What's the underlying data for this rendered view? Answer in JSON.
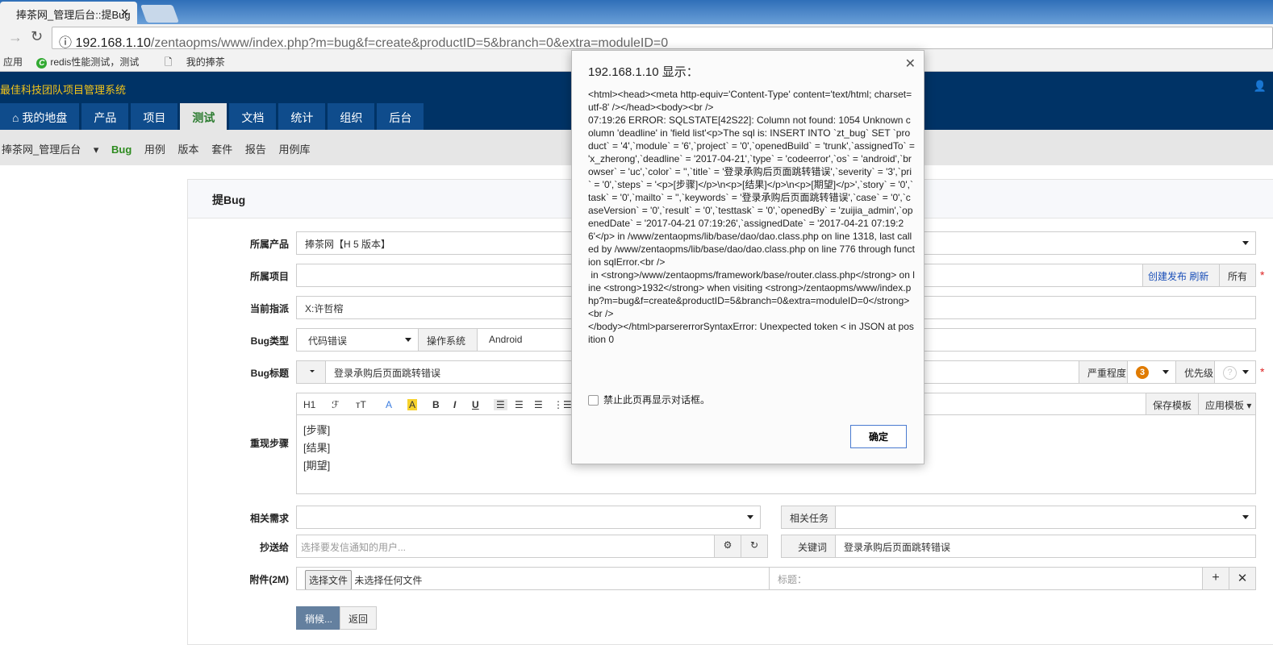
{
  "browser": {
    "tab_title": "捧茶网_管理后台::提Bug",
    "url_host": "192.168.1.10",
    "url_rest": "/zentaopms/www/index.php?m=bug&f=create&productID=5&branch=0&extra=moduleID=0",
    "bookmarks": [
      "应用",
      "redis性能测试，测试",
      "我的捧茶"
    ]
  },
  "app": {
    "title": "最佳科技团队项目管理系统",
    "nav": [
      "我的地盘",
      "产品",
      "项目",
      "测试",
      "文档",
      "统计",
      "组织",
      "后台"
    ],
    "subnav": {
      "product": "捧茶网_管理后台",
      "items": [
        "Bug",
        "用例",
        "版本",
        "套件",
        "报告",
        "用例库"
      ]
    }
  },
  "form": {
    "heading": "提Bug",
    "product_label": "所属产品",
    "product_value": "捧茶网【H 5 版本】",
    "project_label": "所属项目",
    "create_build": "创建发布",
    "refresh": "刷新",
    "all": "所有",
    "assign_label": "当前指派",
    "assign_value": "X:许哲榕",
    "type_label": "Bug类型",
    "type_value": "代码错误",
    "os_label": "操作系统",
    "os_value": "Android",
    "title_label": "Bug标题",
    "title_value": "登录承购后页面跳转错误",
    "severity_label": "严重程度",
    "severity_value": "3",
    "priority_label": "优先级",
    "priority_value": "?",
    "steps_label": "重现步骤",
    "steps_lines": [
      "[步骤]",
      "[结果]",
      "[期望]"
    ],
    "toolbar": {
      "h1": "H1",
      "font": "ℱ",
      "size": "тT",
      "color": "A",
      "bg": "A",
      "bold": "B",
      "italic": "I",
      "underline": "U",
      "save_template": "保存模板",
      "apply_template": "应用模板"
    },
    "story_label": "相关需求",
    "task_label": "相关任务",
    "mailto_label": "抄送给",
    "mailto_placeholder": "选择要发信通知的用户...",
    "keywords_label": "关键词",
    "keywords_value": "登录承购后页面跳转错误",
    "files_label": "附件(2M)",
    "choose_file": "选择文件",
    "no_file": "未选择任何文件",
    "file_title_placeholder": "标题：",
    "submit": "稍候...",
    "back": "返回"
  },
  "dialog": {
    "title": "192.168.1.10 显示：",
    "message": "<html><head><meta http-equiv='Content-Type' content='text/html; charset=utf-8' /></head><body><br />\n07:19:26 ERROR: SQLSTATE[42S22]: Column not found: 1054 Unknown column 'deadline' in 'field list'<p>The sql is: INSERT INTO `zt_bug` SET `product` = '4',`module` = '6',`project` = '0',`openedBuild` = 'trunk',`assignedTo` = 'x_zherong',`deadline` = '2017-04-21',`type` = 'codeerror',`os` = 'android',`browser` = 'uc',`color` = '',`title` = '登录承购后页面跳转错误',`severity` = '3',`pri` = '0',`steps` = '<p>[步骤]</p>\\n<p>[结果]</p>\\n<p>[期望]</p>',`story` = '0',`task` = '0',`mailto` = '',`keywords` = '登录承购后页面跳转错误',`case` = '0',`caseVersion` = '0',`result` = '0',`testtask` = '0',`openedBy` = 'zuijia_admin',`openedDate` = '2017-04-21 07:19:26',`assignedDate` = '2017-04-21 07:19:26'</p> in /www/zentaopms/lib/base/dao/dao.class.php on line 1318, last called by /www/zentaopms/lib/base/dao/dao.class.php on line 776 through function sqlError.<br />\n in <strong>/www/zentaopms/framework/base/router.class.php</strong> on line <strong>1932</strong> when visiting <strong>/zentaopms/www/index.php?m=bug&f=create&productID=5&branch=0&extra=moduleID=0</strong><br />\n</body></html>parsererrorSyntaxError: Unexpected token < in JSON at position 0",
    "checkbox": "禁止此页再显示对话框。",
    "ok": "确定"
  },
  "colors": {
    "header": "#003366",
    "nav": "#0f4c8c",
    "accent": "#f5c518",
    "severity": "#e07b00"
  }
}
